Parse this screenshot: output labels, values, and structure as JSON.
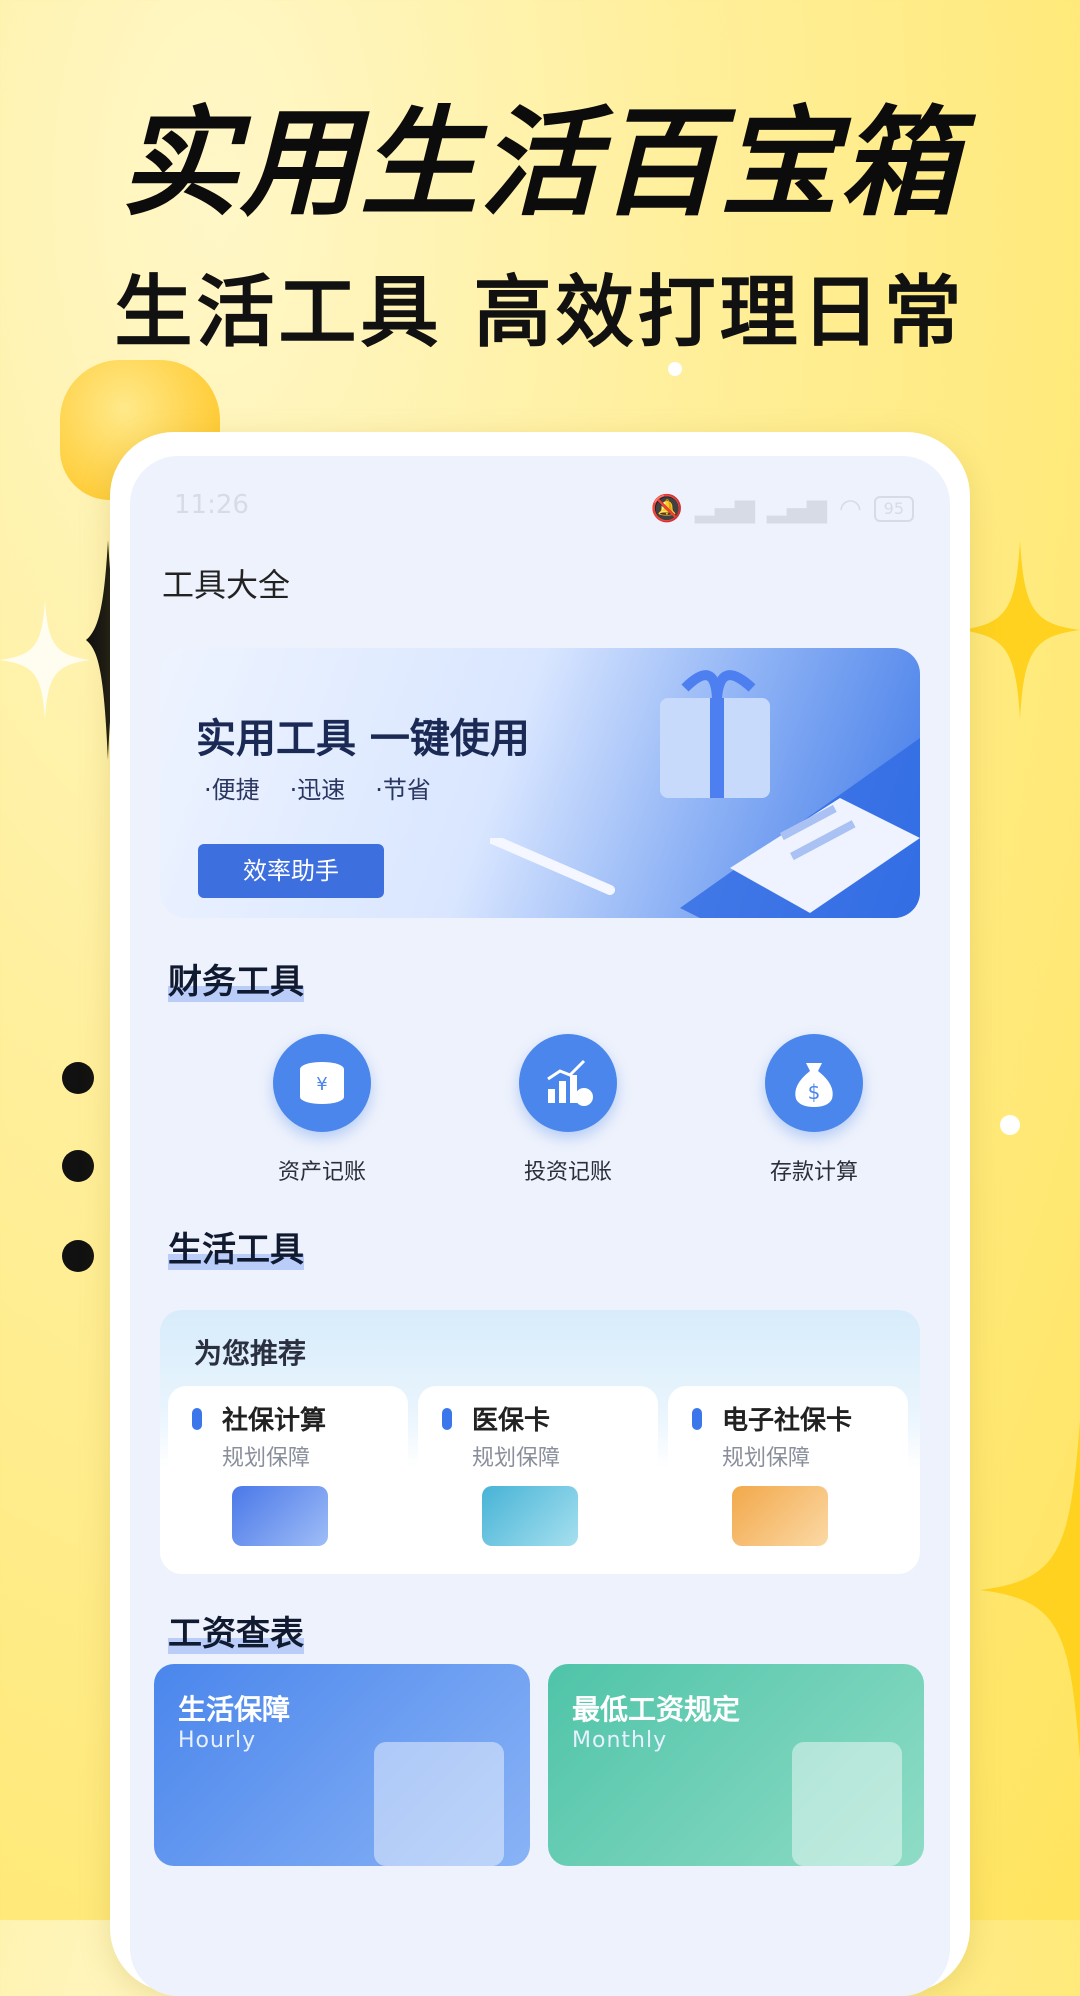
{
  "promo": {
    "headline": "实用生活百宝箱",
    "subline": "生活工具 高效打理日常"
  },
  "status_bar": {
    "time": "11:26",
    "battery": "95"
  },
  "page_title": "工具大全",
  "banner": {
    "title": "实用工具 一键使用",
    "points": [
      "·便捷",
      "·迅速",
      "·节省"
    ],
    "button": "效率助手"
  },
  "sections": {
    "finance": "财务工具",
    "life": "生活工具",
    "wage": "工资查表"
  },
  "finance_tools": [
    {
      "label": "资产记账",
      "icon": "coins-icon"
    },
    {
      "label": "投资记账",
      "icon": "growth-chart-icon"
    },
    {
      "label": "存款计算",
      "icon": "money-bag-icon"
    }
  ],
  "recommend": {
    "title": "为您推荐",
    "cards": [
      {
        "name": "社保计算",
        "sub": "规划保障",
        "icon": "document-card-icon",
        "color": "#4a78e8"
      },
      {
        "name": "医保卡",
        "sub": "规划保障",
        "icon": "id-card-icon",
        "color": "#47b3d6"
      },
      {
        "name": "电子社保卡",
        "sub": "规划保障",
        "icon": "e-card-icon",
        "color": "#f2a84a"
      }
    ]
  },
  "wage_cards": [
    {
      "title": "生活保障",
      "sub": "Hourly",
      "color": "#4a86ec"
    },
    {
      "title": "最低工资规定",
      "sub": "Monthly",
      "color": "#4fc4a8"
    }
  ]
}
